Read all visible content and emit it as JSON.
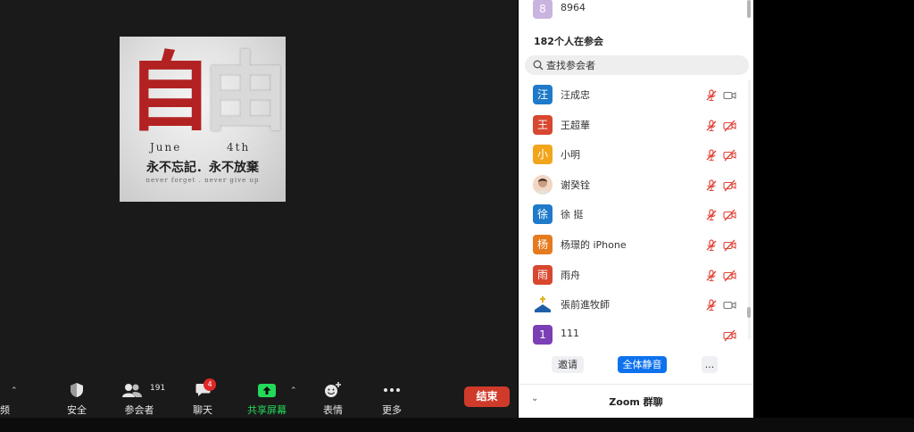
{
  "poster": {
    "char_left": "自",
    "char_right": "由",
    "date_left": "June",
    "date_right": "4th",
    "slogan": "永不忘記．永不放棄",
    "subtitle": "never forget . never give up"
  },
  "toolbar": {
    "partial_label": "频",
    "security_label": "安全",
    "participants_label": "参会者",
    "participants_count": "191",
    "chat_label": "聊天",
    "chat_badge": "4",
    "share_label": "共享屏幕",
    "reactions_label": "表情",
    "more_label": "更多",
    "end_label": "结束",
    "share_color": "#23d959"
  },
  "panel": {
    "top_entry": {
      "avatar": "8",
      "name": "8964",
      "color": "#c9b4e0"
    },
    "count_title": "182个人在参会",
    "search_placeholder": "查找参会者",
    "participants": [
      {
        "avatar": "汪",
        "name": "汪成忠",
        "color": "#1f7ac9",
        "muted": true,
        "cam_off": false
      },
      {
        "avatar": "王",
        "name": "王超華",
        "color": "#d8472f",
        "muted": true,
        "cam_off": true
      },
      {
        "avatar": "小",
        "name": "小明",
        "color": "#f2a51b",
        "muted": true,
        "cam_off": true
      },
      {
        "avatar": "",
        "name": "谢癸铨",
        "color": "#f1d7c4",
        "muted": true,
        "cam_off": true
      },
      {
        "avatar": "徐",
        "name": "徐 挺",
        "color": "#1f7ac9",
        "muted": true,
        "cam_off": true
      },
      {
        "avatar": "杨",
        "name": "杨璟的 iPhone",
        "color": "#e57b1e",
        "muted": true,
        "cam_off": true
      },
      {
        "avatar": "雨",
        "name": "雨舟",
        "color": "#d8472f",
        "muted": true,
        "cam_off": true
      },
      {
        "avatar": "",
        "name": "張前進牧師",
        "color": "#1f5fa8",
        "muted": true,
        "cam_off": false
      },
      {
        "avatar": "1",
        "name": "111",
        "color": "#7b3fb5",
        "muted": false,
        "cam_off": true
      }
    ],
    "invite_label": "邀请",
    "mute_all_label": "全体静音",
    "more_label": "...",
    "chat_title": "Zoom 群聊"
  }
}
